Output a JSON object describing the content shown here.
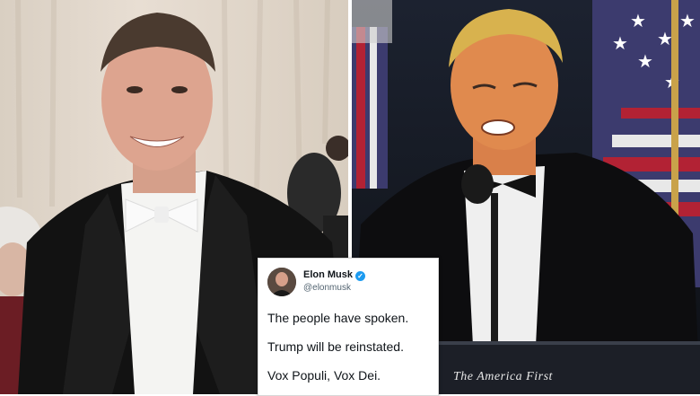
{
  "tweet": {
    "display_name": "Elon Musk",
    "verified_icon": "verified-badge-icon",
    "handle": "@elonmusk",
    "lines": [
      "The people have spoken.",
      "Trump will be reinstated.",
      "Vox Populi, Vox Dei."
    ]
  },
  "lectern": {
    "text": "The America First"
  },
  "colors": {
    "verified": "#1d9bf0",
    "tweet_bg": "#ffffff",
    "flag_red": "#b22234",
    "flag_blue": "#3c3b6e"
  }
}
